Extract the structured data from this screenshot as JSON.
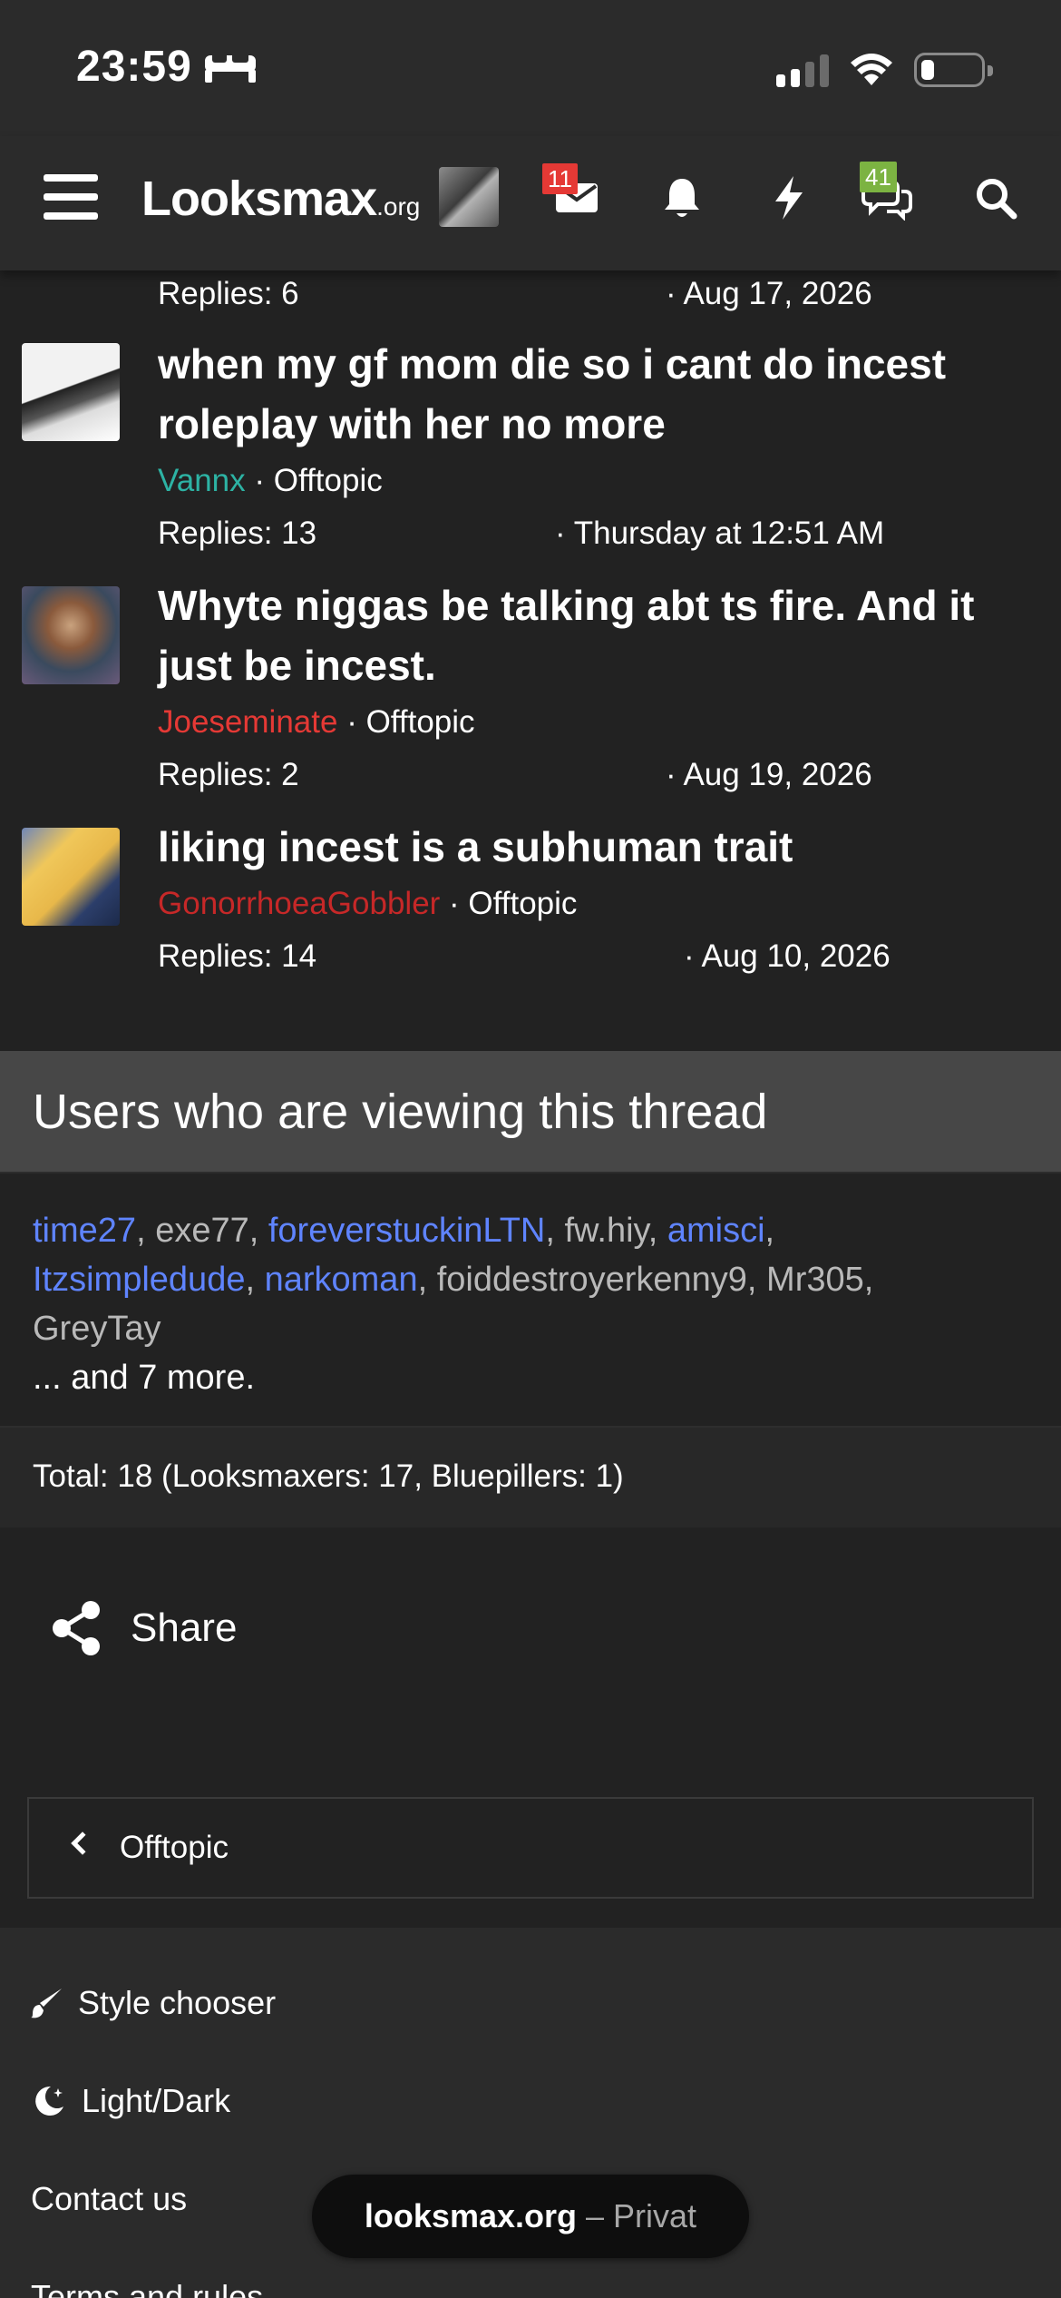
{
  "status_bar": {
    "time": "23:59",
    "icons": [
      "bed-icon",
      "cellular-signal-icon",
      "wifi-icon",
      "battery-icon"
    ]
  },
  "navbar": {
    "logo_main": "Looksmax",
    "logo_suffix": ".org",
    "icons": [
      "hamburger-menu-icon",
      "envelope-icon",
      "bell-icon",
      "lightning-icon",
      "chat-bubbles-icon",
      "search-icon"
    ],
    "inbox_badge": "11",
    "alerts_badge": "41",
    "colors": {
      "inbox_badge": "#e53935",
      "alerts_badge": "#7cb342"
    }
  },
  "threads": {
    "partial_top": {
      "replies": "Replies: 6",
      "date": "· Aug 17, 2026"
    },
    "items": [
      {
        "title": "when my gf mom die so i cant do incest roleplay with her no more",
        "author": "Vannx",
        "author_color": "#2db3a4",
        "forum": "· Offtopic",
        "replies": "Replies: 13",
        "date": "· Thursday at 12:51 AM"
      },
      {
        "title": "Whyte niggas be talking abt ts fire. And it just be incest.",
        "author": "Joeseminate",
        "author_color": "#e53935",
        "forum": "· Offtopic",
        "replies": "Replies: 2",
        "date": "· Aug 19, 2026"
      },
      {
        "title": "liking incest is a subhuman trait",
        "author": "GonorrhoeaGobbler",
        "author_color": "#c62828",
        "forum": "· Offtopic",
        "replies": "Replies: 14",
        "date": "· Aug 10, 2026"
      }
    ]
  },
  "viewing": {
    "heading": "Users who are viewing this thread",
    "users": [
      {
        "name": "time27",
        "color": "blue"
      },
      {
        "name": "exe77",
        "color": "grey"
      },
      {
        "name": "foreverstuckinLTN",
        "color": "blue"
      },
      {
        "name": "fw.hiy",
        "color": "grey"
      },
      {
        "name": "amisci",
        "color": "blue"
      },
      {
        "name": "Itzsimpledude",
        "color": "blue"
      },
      {
        "name": "narkoman",
        "color": "blue"
      },
      {
        "name": "foiddestroyerkenny9",
        "color": "grey"
      },
      {
        "name": "Mr305",
        "color": "grey"
      },
      {
        "name": "GreyTay",
        "color": "grey"
      }
    ],
    "more": "... and 7 more.",
    "total": "Total: 18 (Looksmaxers: 17, Bluepillers: 1)"
  },
  "share_label": "Share",
  "back_label": "Offtopic",
  "footer": {
    "style_chooser": "Style chooser",
    "light_dark": "Light/Dark",
    "contact": "Contact us",
    "terms_partial": "Terms and rules"
  },
  "url_pill": {
    "host": "looksmax.org",
    "sep": "–",
    "mode": "Privat"
  }
}
